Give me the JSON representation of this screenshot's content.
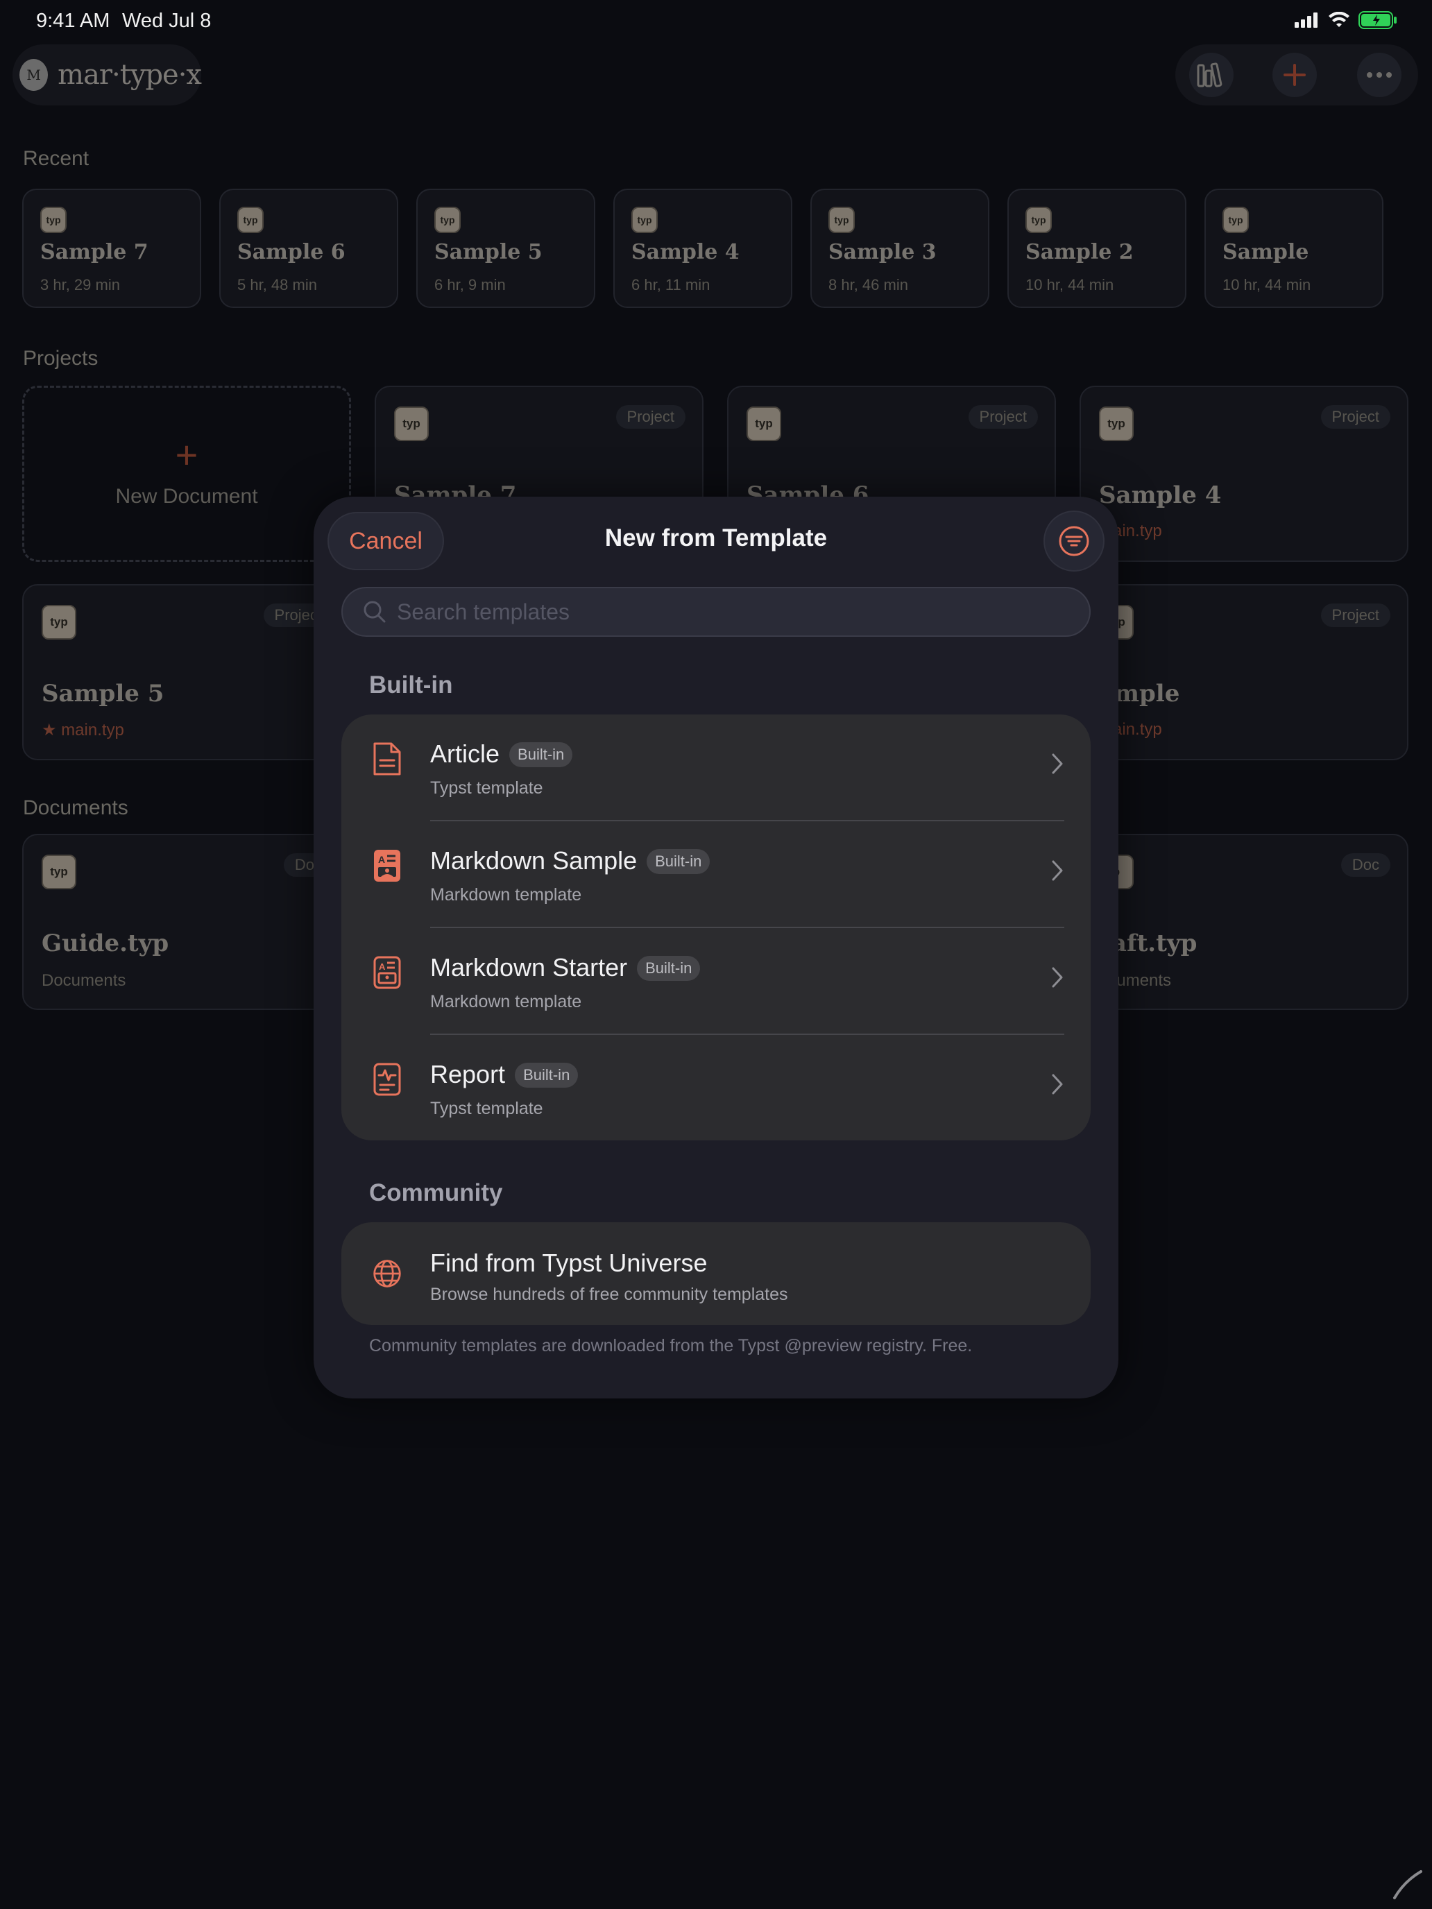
{
  "status_bar": {
    "time": "9:41 AM",
    "date": "Wed Jul 8"
  },
  "app": {
    "brand_initial": "M",
    "brand_name": "mar·type·x"
  },
  "colors": {
    "accent": "#e7745c",
    "background": "#0b0c11",
    "modal": "#1d1d27",
    "list": "#2c2c2f"
  },
  "top_buttons": [
    {
      "icon": "library-icon"
    },
    {
      "icon": "plus-icon"
    },
    {
      "icon": "more-icon"
    }
  ],
  "recent": {
    "label": "Recent",
    "items": [
      {
        "badge": "typ",
        "title": "Sample 7",
        "time": "3 hr, 29 min"
      },
      {
        "badge": "typ",
        "title": "Sample 6",
        "time": "5 hr, 48 min"
      },
      {
        "badge": "typ",
        "title": "Sample 5",
        "time": "6 hr, 9 min"
      },
      {
        "badge": "typ",
        "title": "Sample 4",
        "time": "6 hr, 11 min"
      },
      {
        "badge": "typ",
        "title": "Sample 3",
        "time": "8 hr, 46 min"
      },
      {
        "badge": "typ",
        "title": "Sample 2",
        "time": "10 hr, 44 min"
      },
      {
        "badge": "typ",
        "title": "Sample",
        "time": "10 hr, 44 min"
      }
    ]
  },
  "projects": {
    "label": "Projects",
    "new_document": "New Document",
    "cards": [
      {
        "badge": "typ",
        "kind": "Project",
        "title": "Sample 7",
        "sub": ""
      },
      {
        "badge": "typ",
        "kind": "Project",
        "title": "Sample 6",
        "sub": ""
      },
      {
        "badge": "typ",
        "kind": "Project",
        "title": "Sample 4",
        "sub": "main.typ"
      },
      {
        "badge": "typ",
        "kind": "Project",
        "title": "Sample 5",
        "sub": "★ main.typ"
      },
      {
        "badge": "typ",
        "kind": "Project",
        "title": "ample",
        "sub": "main.typ"
      }
    ]
  },
  "documents": {
    "label": "Documents",
    "cards": [
      {
        "badge": "typ",
        "kind": "Doc",
        "title": "Guide.typ",
        "sub": "Documents"
      },
      {
        "badge": "p",
        "kind": "Doc",
        "title": "raft.typ",
        "sub": "ocuments"
      }
    ]
  },
  "modal": {
    "cancel": "Cancel",
    "title": "New from Template",
    "search_placeholder": "Search templates",
    "builtin_heading": "Built-in",
    "templates": [
      {
        "title": "Article",
        "badge": "Built-in",
        "subtitle": "Typst template",
        "icon": "document-icon"
      },
      {
        "title": "Markdown Sample",
        "badge": "Built-in",
        "subtitle": "Markdown template",
        "icon": "markdown-filled-icon"
      },
      {
        "title": "Markdown Starter",
        "badge": "Built-in",
        "subtitle": "Markdown template",
        "icon": "markdown-outline-icon"
      },
      {
        "title": "Report",
        "badge": "Built-in",
        "subtitle": "Typst template",
        "icon": "report-icon"
      }
    ],
    "community_heading": "Community",
    "community": {
      "title": "Find from Typst Universe",
      "subtitle": "Browse hundreds of free community templates",
      "icon": "globe-icon"
    },
    "footnote": "Community templates are downloaded from the Typst @preview registry. Free."
  }
}
